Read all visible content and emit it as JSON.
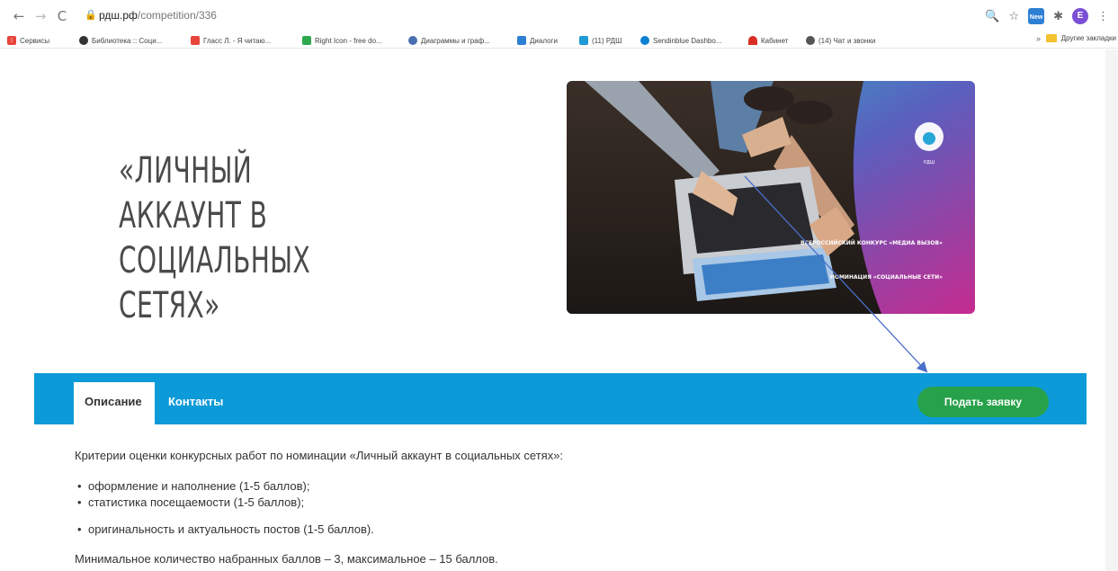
{
  "browser": {
    "url_host": "рдш.рф",
    "url_path": "/competition/336",
    "profile_initial": "E",
    "ext_badge": "New",
    "bookmarks": [
      {
        "label": "Сервисы",
        "color": "#e8453c"
      },
      {
        "label": "Библиотека :: Соци...",
        "color": "#333333"
      },
      {
        "label": "Гласс Л. - Я читаю...",
        "color": "#e8453c"
      },
      {
        "label": "Right Icon - free do...",
        "color": "#2fa84f"
      },
      {
        "label": "Диаграммы и граф...",
        "color": "#4a6fb0"
      },
      {
        "label": "Диалоги",
        "color": "#2d7fd3"
      },
      {
        "label": "(11) РДШ",
        "color": "#1e9ad6"
      },
      {
        "label": "Sendinblue Dashbo...",
        "color": "#0b7fd1"
      },
      {
        "label": "Кабинет",
        "color": "#d93025"
      },
      {
        "label": "(14) Чат и звонки",
        "color": "#555555"
      }
    ],
    "more": "»",
    "other_bookmarks": "Другие закладки"
  },
  "hero": {
    "title": "«ЛИЧНЫЙ АККАУНТ В СОЦИАЛЬНЫХ СЕТЯХ»",
    "poster_contest": "ВСЕРОССИЙСКИЙ КОНКУРС «МЕДИА ВЫЗОВ»",
    "poster_nomination": "НОМИНАЦИЯ «СОЦИАЛЬНЫЕ СЕТИ»"
  },
  "tabs": {
    "description": "Описание",
    "contacts": "Контакты",
    "apply": "Подать заявку"
  },
  "content": {
    "intro": "Критерии оценки конкурсных работ по номинации «Личный аккаунт в социальных сетях»:",
    "criteria": [
      "оформление и наполнение (1-5 баллов);",
      "статистика посещаемости (1-5 баллов);",
      "оригинальность и актуальность постов (1-5 баллов)."
    ],
    "score_range": "Минимальное количество набранных баллов – 3, максимальное – 15 баллов."
  },
  "colors": {
    "tab_bar": "#0d9ad8",
    "apply_button": "#27a24a",
    "arrow": "#4a6fc9"
  }
}
